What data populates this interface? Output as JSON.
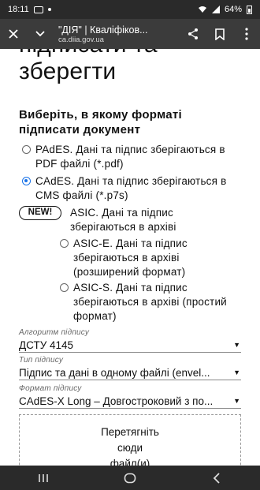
{
  "status_bar": {
    "time": "18:11",
    "battery": "64%",
    "icons": [
      "gallery-icon",
      "notification-dot-icon",
      "wifi-icon",
      "signal-icon",
      "battery-icon"
    ]
  },
  "browser": {
    "page_title": "\"ДІЯ\" | Кваліфіков...",
    "url": "ca.diia.gov.ua",
    "icons": [
      "close-icon",
      "chevron-down-icon",
      "share-icon",
      "bookmark-icon",
      "more-vert-icon"
    ]
  },
  "page": {
    "heading_line1": "підписати та",
    "heading_line2": "зберегти",
    "format_question": "Виберіть, в якому форматі підписати документ",
    "options": [
      {
        "text": "PAdES. Дані та підпис зберігаються в PDF файлі (*.pdf)",
        "checked": false
      },
      {
        "text": "CAdES. Дані та підпис зберігаються в CMS файлі (*.p7s)",
        "checked": true
      }
    ],
    "new_badge": "NEW!",
    "asic_label": "ASIC. Дані та підпис зберігаються в архіві",
    "asic_options": [
      {
        "text": "ASIC-E. Дані та підпис зберігаються в архіві (розширений формат)",
        "checked": false
      },
      {
        "text": "ASIC-S. Дані та підпис зберігаються в архіві (простий формат)",
        "checked": false
      }
    ],
    "algorithm": {
      "label": "Алгоритм підпису",
      "value": "ДСТУ 4145"
    },
    "signature_type": {
      "label": "Тип підпису",
      "value": "Підпис та дані в одному файлі (envel..."
    },
    "signature_format": {
      "label": "Формат підпису",
      "value": "CAdES-X Long – Довгостроковий з по..."
    },
    "dropzone_text": "Перетягніть сюди файл(и)"
  },
  "colors": {
    "accent": "#1a73e8",
    "chrome": "#3b3b3b",
    "status": "#2a2a2a"
  }
}
